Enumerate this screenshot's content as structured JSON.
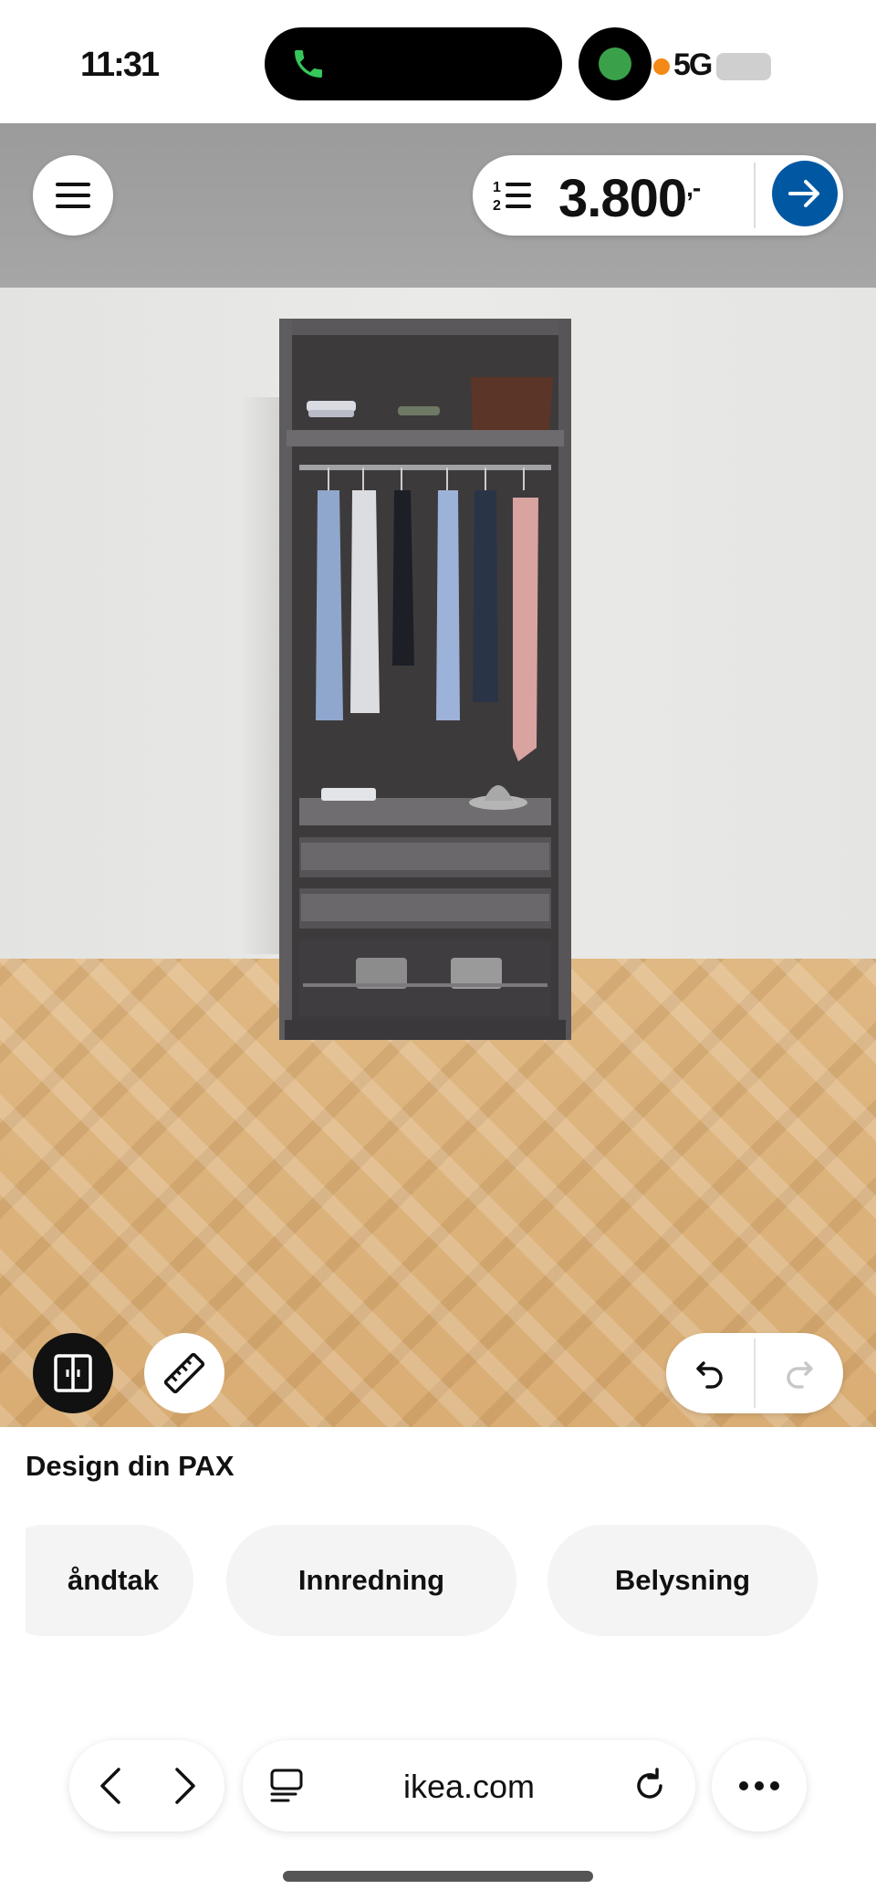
{
  "status_bar": {
    "time": "11:31",
    "indicators": "5G",
    "icons": [
      "phone-icon",
      "avatar-icon",
      "recording-icon",
      "signal-icon",
      "battery-icon"
    ]
  },
  "header": {
    "menu_icon": "hamburger-icon",
    "cart_icon": "numbered-list-icon",
    "price": "3.800",
    "price_suffix": ",-",
    "arrow_icon": "arrow-right-icon"
  },
  "scene": {
    "description": "PAX wardrobe 3D view"
  },
  "tools": {
    "doors_icon": "doors-icon",
    "measure_icon": "ruler-icon",
    "undo_icon": "undo-icon",
    "redo_icon": "redo-icon"
  },
  "design_panel": {
    "title": "Design din PAX",
    "chips": [
      "åndtak",
      "Innredning",
      "Belysning"
    ]
  },
  "browser": {
    "url": "ikea.com",
    "back_icon": "chevron-left-icon",
    "forward_icon": "chevron-right-icon",
    "tabs_icon": "tabs-icon",
    "reload_icon": "reload-icon",
    "more_icon": "more-icon"
  },
  "colors": {
    "brand_blue": "#0058a3",
    "chip_bg": "#f4f4f4",
    "dark_button": "#111111"
  }
}
